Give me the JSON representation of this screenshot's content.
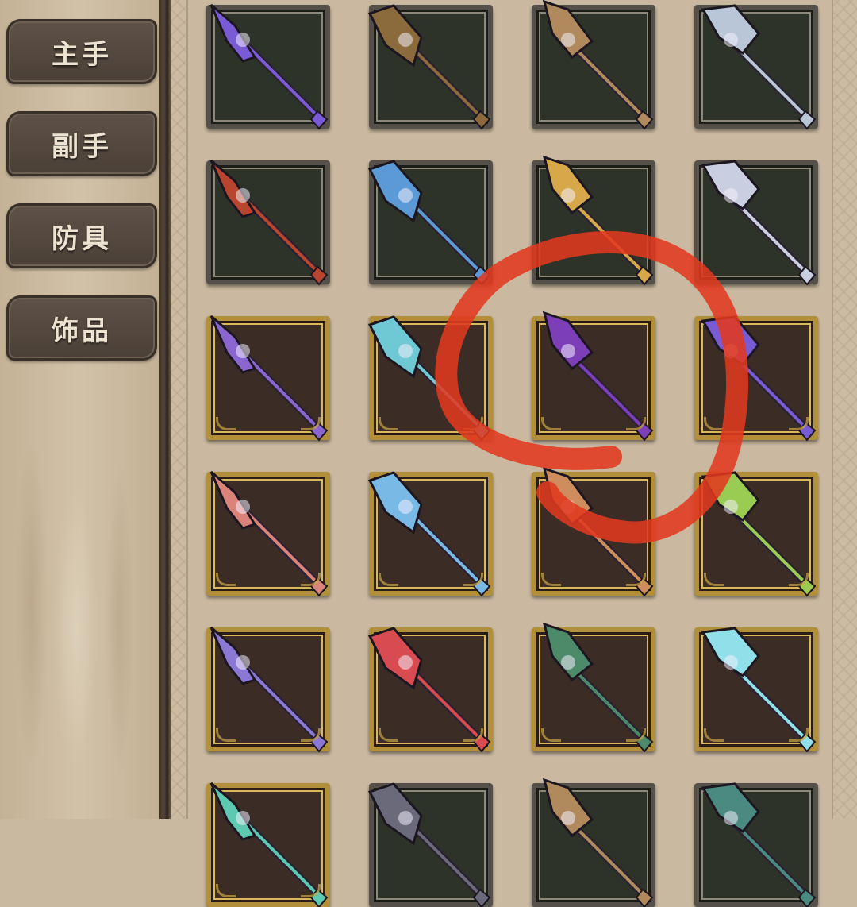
{
  "sidebar": {
    "tabs": [
      {
        "label": "主手"
      },
      {
        "label": "副手"
      },
      {
        "label": "防具"
      },
      {
        "label": "饰品"
      }
    ]
  },
  "weapons": {
    "rows": [
      [
        {
          "icon": "purple-crystal-spear-icon",
          "frame": "dark",
          "accent": "#7a5bd6"
        },
        {
          "icon": "twisted-vine-spear-icon",
          "frame": "dark",
          "accent": "#8b6a3c"
        },
        {
          "icon": "wooden-eye-staff-icon",
          "frame": "dark",
          "accent": "#b08a5c"
        },
        {
          "icon": "silver-amethyst-scepter-icon",
          "frame": "dark",
          "accent": "#b9c6d8"
        }
      ],
      [
        {
          "icon": "crimson-demon-staff-icon",
          "frame": "dark",
          "accent": "#b8452f"
        },
        {
          "icon": "frost-spiral-spear-icon",
          "frame": "dark",
          "accent": "#5b9ad6"
        },
        {
          "icon": "golden-lightning-spear-icon",
          "frame": "dark",
          "accent": "#d7a84a"
        },
        {
          "icon": "silver-spiral-lance-icon",
          "frame": "dark",
          "accent": "#c9cfe0"
        }
      ],
      [
        {
          "icon": "star-void-staff-icon",
          "frame": "gold",
          "accent": "#8b66d1"
        },
        {
          "icon": "dark-crystal-spear-icon",
          "frame": "gold",
          "accent": "#6fc9d4"
        },
        {
          "icon": "purple-vortex-staff-icon",
          "frame": "gold",
          "accent": "#7d3fb8"
        },
        {
          "icon": "violet-crystal-spear-icon",
          "frame": "gold",
          "accent": "#7a5bd6"
        }
      ],
      [
        {
          "icon": "coral-bone-staff-icon",
          "frame": "gold",
          "accent": "#d9837a"
        },
        {
          "icon": "azure-winged-staff-icon",
          "frame": "gold",
          "accent": "#79b9e6"
        },
        {
          "icon": "ember-hook-staff-icon",
          "frame": "gold",
          "accent": "#cf8c5c"
        },
        {
          "icon": "horned-nature-staff-icon",
          "frame": "gold",
          "accent": "#9acb52"
        }
      ],
      [
        {
          "icon": "lightning-trident-icon",
          "frame": "gold",
          "accent": "#8a78d4"
        },
        {
          "icon": "crimson-eye-scepter-icon",
          "frame": "gold",
          "accent": "#d84b50"
        },
        {
          "icon": "thorn-vine-staff-icon",
          "frame": "gold",
          "accent": "#4d8a6a"
        },
        {
          "icon": "ice-star-spear-icon",
          "frame": "gold",
          "accent": "#8fe0e8"
        }
      ],
      [
        {
          "icon": "partial-item-icon",
          "frame": "gold",
          "accent": "#5cc9b0"
        },
        {
          "icon": "partial-item-icon",
          "frame": "dark",
          "accent": "#6a6a7a"
        },
        {
          "icon": "partial-item-icon",
          "frame": "dark",
          "accent": "#b08a5c"
        },
        {
          "icon": "partial-item-icon",
          "frame": "dark",
          "accent": "#4a8a80"
        }
      ]
    ]
  },
  "annotation": {
    "color": "#e0391f"
  }
}
